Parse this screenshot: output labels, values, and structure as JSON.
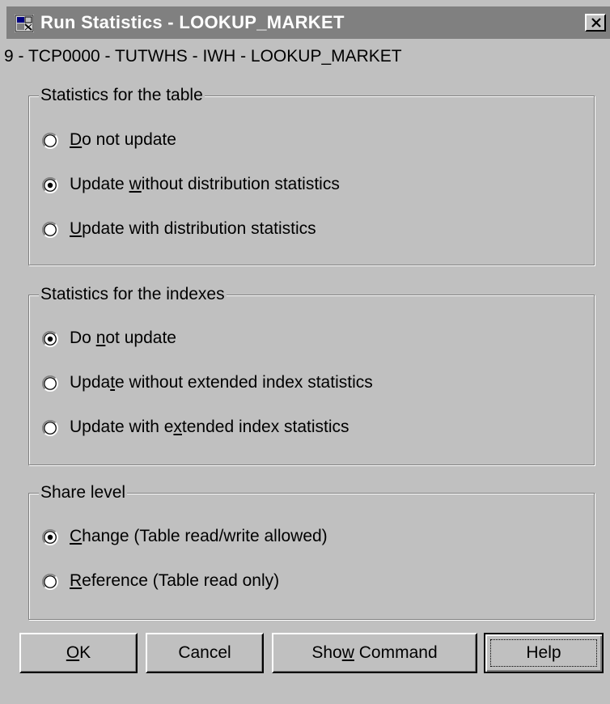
{
  "window": {
    "title": "Run Statistics - LOOKUP_MARKET",
    "icon": "run-statistics-app-icon",
    "close_icon": "close-icon"
  },
  "path": "9 - TCP0000 - TUTWHS - IWH - LOOKUP_MARKET",
  "table_stats": {
    "label": "Statistics for the table",
    "options": [
      {
        "pre": "",
        "accel": "D",
        "post": "o not update",
        "selected": false
      },
      {
        "pre": "Update ",
        "accel": "w",
        "post": "ithout distribution statistics",
        "selected": true
      },
      {
        "pre": "",
        "accel": "U",
        "post": "pdate with distribution statistics",
        "selected": false
      }
    ]
  },
  "index_stats": {
    "label": "Statistics for the indexes",
    "options": [
      {
        "pre": "Do ",
        "accel": "n",
        "post": "ot update",
        "selected": true
      },
      {
        "pre": "Upda",
        "accel": "t",
        "post": "e without extended index statistics",
        "selected": false
      },
      {
        "pre": "Update with e",
        "accel": "x",
        "post": "tended index statistics",
        "selected": false
      }
    ]
  },
  "share_level": {
    "label": "Share level",
    "options": [
      {
        "pre": "",
        "accel": "C",
        "post": "hange (Table read/write allowed)",
        "selected": true
      },
      {
        "pre": "",
        "accel": "R",
        "post": "eference (Table read only)",
        "selected": false
      }
    ]
  },
  "buttons": {
    "ok": {
      "pre": "",
      "accel": "O",
      "post": "K"
    },
    "cancel": {
      "label": "Cancel"
    },
    "show_command": {
      "pre": "Sho",
      "accel": "w",
      "post": " Command"
    },
    "help": {
      "label": "Help"
    }
  }
}
